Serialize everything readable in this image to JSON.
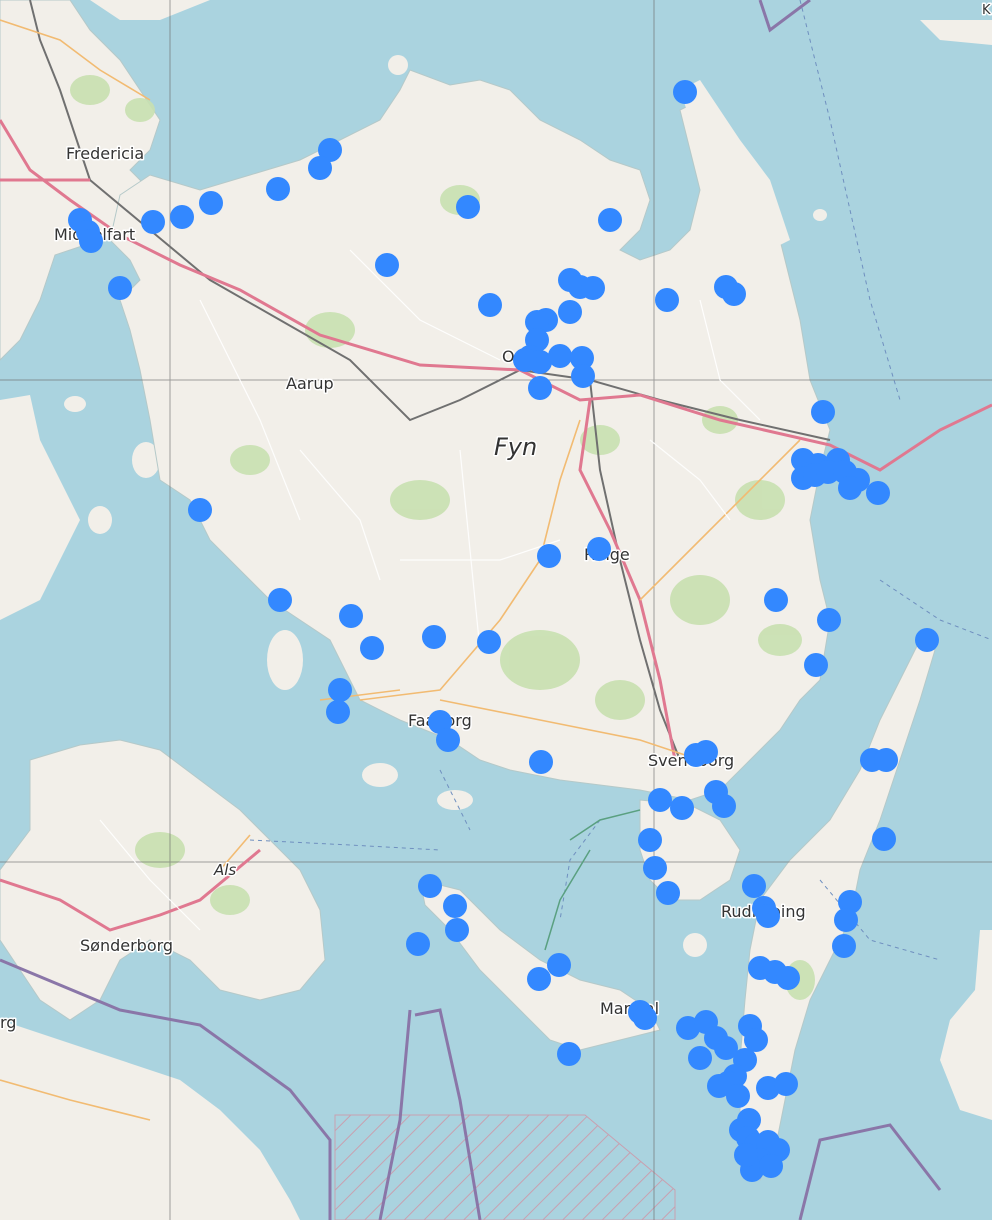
{
  "map": {
    "colors": {
      "water": "#aad3df",
      "land": "#f2efe9",
      "forest": "#b8d8a0",
      "motorway": "#e07890",
      "primary": "#f7c98a",
      "rail": "#707070",
      "border": "#7a6a9a",
      "marker": "#3388ff"
    },
    "labels": {
      "fredericia": "Fredericia",
      "middelfart": "Middelfart",
      "odense": "O",
      "aarup": "Aarup",
      "fyn": "Fyn",
      "ringe": "Ringe",
      "faaborg": "Faaborg",
      "svendborg": "Svendborg",
      "als": "Als",
      "sonderborg": "Sønderborg",
      "rudkobing": "Rudkøbing",
      "marstal": "Marstal",
      "corner_rg": "rg",
      "corner_k": "K"
    },
    "marker_icon": "location-marker-icon",
    "marker_count": 150
  }
}
